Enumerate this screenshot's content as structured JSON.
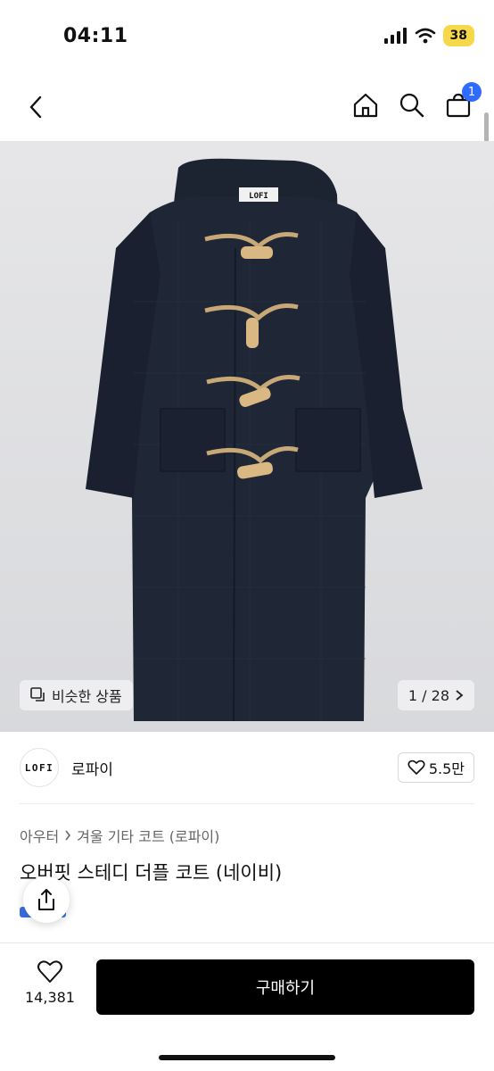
{
  "status": {
    "time": "04:11",
    "battery": "38"
  },
  "nav": {
    "cart_count": "1"
  },
  "image": {
    "similar_label": "비슷한 상품",
    "pager": "1 / 28",
    "garment_label": "LOFI"
  },
  "brand": {
    "logo_text": "LOFI",
    "name": "로파이",
    "likes": "5.5만"
  },
  "breadcrumb": [
    "아우터",
    "겨울 기타 코트 (로파이)"
  ],
  "product": {
    "title": "오버핏 스테디 더플 코트 (네이비)"
  },
  "bottom": {
    "wish_count": "14,381",
    "buy_label": "구매하기"
  },
  "colors": {
    "accent": "#2f6bff",
    "battery": "#f7d84b",
    "coat": "#1c2331",
    "toggle": "#c9a878"
  }
}
